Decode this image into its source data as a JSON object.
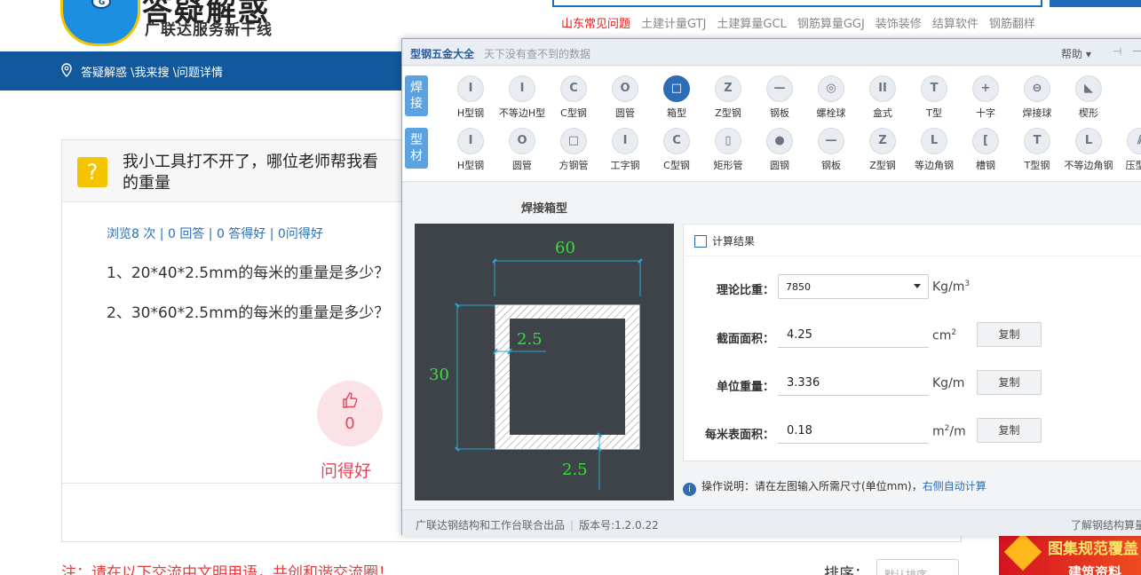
{
  "site": {
    "title": "答疑解惑",
    "slogan": "广联达服务新干线",
    "nav": [
      "山东常见问题",
      "土建计量GTJ",
      "土建算量GCL",
      "钢筋算量GGJ",
      "装饰装修",
      "结算软件",
      "钢筋翻样"
    ],
    "breadcrumb": "答疑解惑 \\我来搜 \\问题详情"
  },
  "question": {
    "title": "我小工具打不开了，哪位老师帮我看",
    "title_line2": "的重量",
    "stats": "浏览8 次 | 0 回答 | 0 答得好 | 0问得好",
    "lines": [
      "1、20*40*2.5mm的每米的重量是多少？",
      "2、30*60*2.5mm的每米的重量是多少？"
    ],
    "like_count": "0",
    "like_label": "问得好"
  },
  "footer_area": {
    "note": "注：请在以下交流中文明用语，共创和谐交流圈！",
    "sort_label": "排序：",
    "sort_value": "默认排序",
    "ad_line1": "图集规范覆盖",
    "ad_line2": "建筑资料"
  },
  "tool": {
    "title": "型钢五金大全",
    "subtitle": "天下没有查不到的数据",
    "help": "帮助",
    "categories": {
      "weld": "焊接",
      "profile": "型材"
    },
    "weld_shapes": [
      "H型钢",
      "不等边H型",
      "C型钢",
      "圆管",
      "箱型",
      "Z型钢",
      "钢板",
      "螺栓球",
      "盒式",
      "T型",
      "十字",
      "焊接球",
      "楔形"
    ],
    "profile_shapes": [
      "H型钢",
      "圆管",
      "方钢管",
      "工字钢",
      "C型钢",
      "矩形管",
      "圆钢",
      "钢板",
      "Z型钢",
      "等边角钢",
      "槽钢",
      "T型钢",
      "不等边角钢",
      "压型钢"
    ],
    "selected_shape": "箱型",
    "diagram_title": "焊接箱型",
    "dims": {
      "width": "60",
      "height": "30",
      "web_thickness": "2.5",
      "flange_thickness": "2.5"
    },
    "results_title": "计算结果",
    "density": {
      "label": "理论比重：",
      "value": "7850",
      "unit": "Kg/m",
      "unit_sup": "3"
    },
    "area": {
      "label": "截面面积：",
      "value": "4.25",
      "unit": "cm",
      "unit_sup": "2",
      "copy": "复制"
    },
    "unit_weight": {
      "label": "单位重量：",
      "value": "3.336",
      "unit": "Kg/m",
      "copy": "复制"
    },
    "surface": {
      "label": "每米表面积：",
      "value": "0.18",
      "unit": "m",
      "unit_sup": "2",
      "unit_tail": "/m",
      "copy": "复制"
    },
    "instructions": "操作说明：请在左图输入所需尺寸(单位mm)，",
    "instructions_link": "右侧自动计算",
    "footer_maker": "广联达钢结构和工作台联合出品",
    "footer_version": "版本号:1.2.0.22",
    "footer_right": "了解钢结构算量"
  },
  "colors": {
    "brand_blue": "#11589d",
    "accent_red": "#e0475b",
    "dim_green": "#3cdc3c",
    "selected": "#2c6db6"
  }
}
